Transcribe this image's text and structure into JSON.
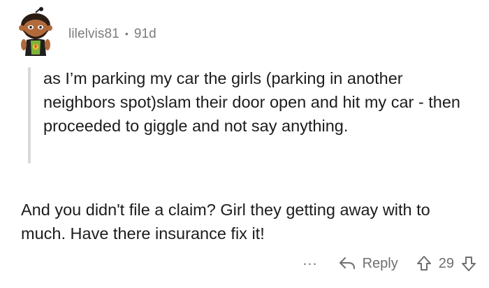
{
  "comment": {
    "username": "lilelvis81",
    "separator": "•",
    "age": "91d",
    "quote": "as I’m parking my car the girls (parking in another neighbors spot)slam their door open and hit my car - then proceeded to giggle and not say anything.",
    "body": "And you didn't file a claim? Girl they getting away with to much. Have there insurance fix it!"
  },
  "actions": {
    "more_label": "...",
    "reply_label": "Reply",
    "vote_count": "29"
  },
  "icons": {
    "avatar": "snoo-avatar-icon",
    "reply": "reply-arrow-icon",
    "upvote": "upvote-arrow-icon",
    "downvote": "downvote-arrow-icon"
  },
  "colors": {
    "text": "#1c1c1c",
    "meta": "#7c7c7c",
    "quote_bar": "#d9d9d9"
  }
}
